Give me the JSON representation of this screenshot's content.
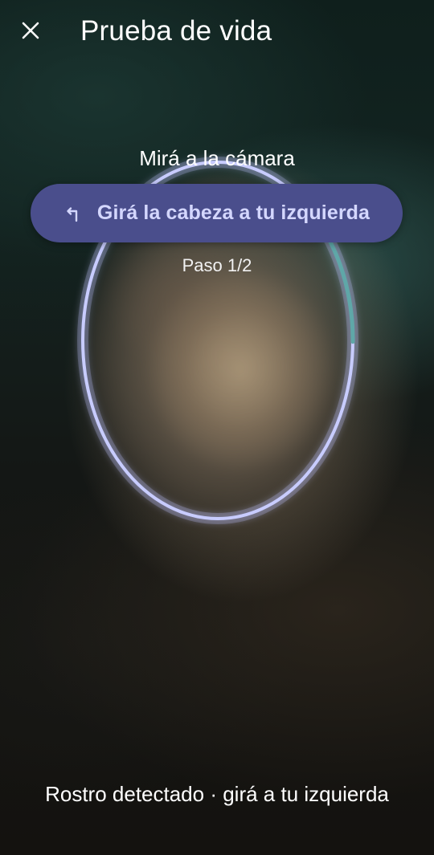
{
  "header": {
    "title": "Prueba de vida",
    "close_icon": "close-icon"
  },
  "camera": {
    "look_label": "Mirá a la cámara",
    "instruction": "Girá la cabeza a tu izquierda",
    "instruction_icon": "turn-left-arrow-icon",
    "step": "Paso 1/2",
    "progress": 0.12
  },
  "footer": {
    "status": "Rostro detectado · girá a tu izquierda"
  },
  "colors": {
    "pill_background": "#4a4e8c",
    "pill_text": "#d4d7ff",
    "oval_ring": "#c8ccff",
    "progress_arc": "#5fa7a8"
  }
}
